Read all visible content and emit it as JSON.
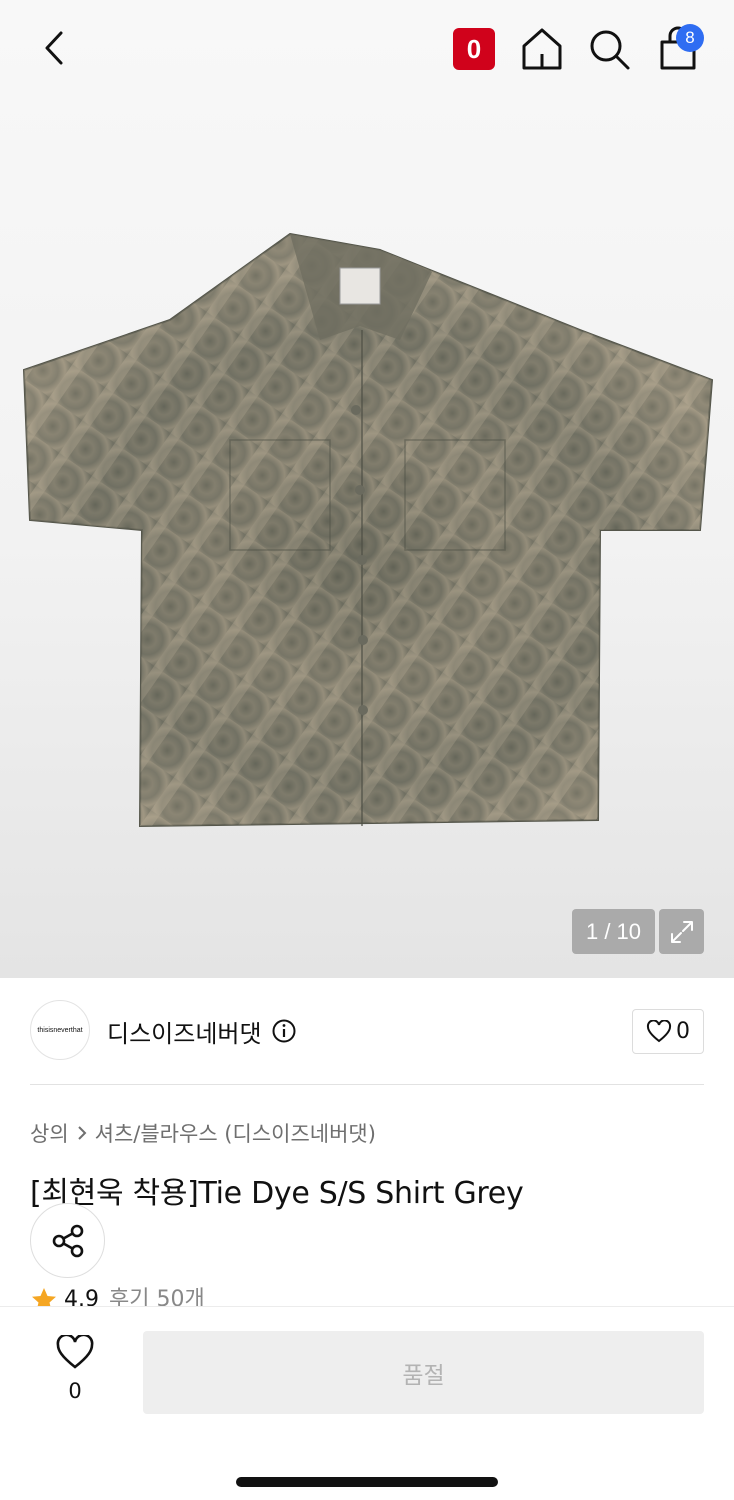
{
  "header": {
    "brand_badge_letter": "0",
    "cart_count": "8",
    "icons": [
      "chevron-left-icon",
      "home-icon",
      "search-icon",
      "shopping-bag-icon"
    ]
  },
  "gallery": {
    "counter": "1 / 10",
    "expand_icon": "expand-icon"
  },
  "brand": {
    "logo_text": "thisisneverthat",
    "name": "디스이즈네버댓",
    "like_count": "0"
  },
  "breadcrumb": {
    "level1": "상의",
    "level2": "셔츠/블라우스 (디스이즈네버댓)"
  },
  "product": {
    "title": "[최현욱 착용]Tie Dye S/S Shirt Grey",
    "rating": "4.9",
    "review_label": "후기 50개"
  },
  "bottom": {
    "wish_count": "0",
    "buy_label": "품절"
  },
  "colors": {
    "accent_red": "#d0021b",
    "badge_blue": "#2f6df2",
    "star": "#f5a623"
  }
}
